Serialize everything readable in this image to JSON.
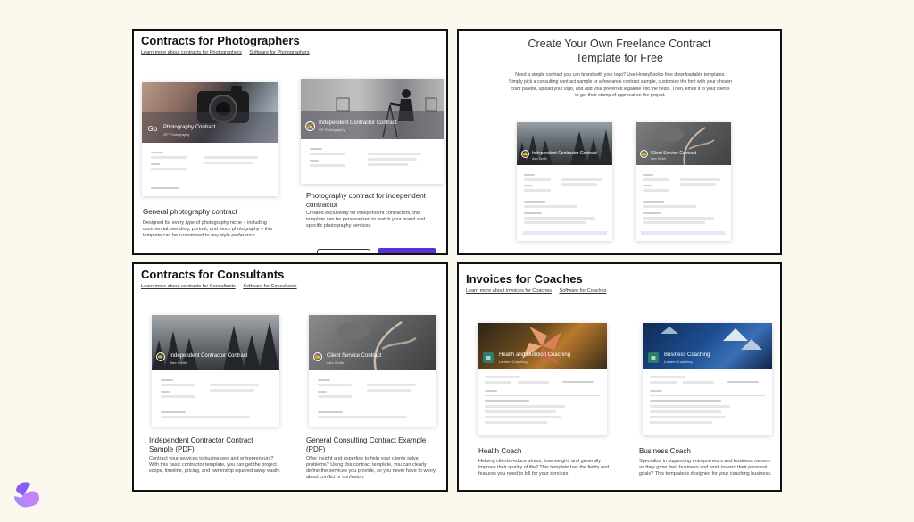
{
  "panels": {
    "photographers": {
      "title": "Contracts for Photographers",
      "links": [
        "Learn more about contracts for Photographers",
        "Software for Photographers"
      ],
      "cards": [
        {
          "thumb_title": "Photography Contract",
          "thumb_sub": "GP Photography",
          "badge": "Gp",
          "title": "General photography contract",
          "desc": "Designed for every type of photography niche – including commercial, wedding, portrait, and stock photography – this template can be customized to any style preference."
        },
        {
          "thumb_title": "Independent Contractor Contract",
          "thumb_sub": "GP Photography",
          "title": "Photography contract for independent contractor",
          "desc": "Created exclusively for independent contractors, this template can be personalized to match your brand and specific photography services."
        }
      ]
    },
    "freelance": {
      "title": "Create Your Own Freelance Contract Template for Free",
      "intro": "Need a simple contract you can brand with your logo? Use HoneyBook's free downloadable templates. Simply pick a consulting contract sample or a freelance contract sample, customize the font with your chosen color palette, upload your logo, and add your preferred legalese into the fields. Then, email it to your clients to get their stamp of approval on the project.",
      "cards": [
        {
          "thumb_title": "Independent Contractor Contract",
          "thumb_sub": "Alex Smith"
        },
        {
          "thumb_title": "Client Service Contract",
          "thumb_sub": "Alex Smith"
        }
      ]
    },
    "consultants": {
      "title": "Contracts for Consultants",
      "links": [
        "Learn more about contracts for Consultants",
        "Software for Consultants"
      ],
      "cards": [
        {
          "thumb_title": "Independent Contractor Contract",
          "thumb_sub": "Alex Smith",
          "title": "Independent Contractor Contract Sample (PDF)",
          "desc": "Contract your services to businesses and entrepreneurs? With this basic contractor template, you can get the project scope, timeline, pricing, and ownership squared away easily."
        },
        {
          "thumb_title": "Client Service Contract",
          "thumb_sub": "Alex Smith",
          "title": "General Consulting Contract Example (PDF)",
          "desc": "Offer insight and expertise to help your clients solve problems? Using this contract template, you can clearly define the services you provide, so you never have to worry about conflict or confusion."
        }
      ]
    },
    "coaches": {
      "title": "Invoices for Coaches",
      "links": [
        "Learn more about invoices for Coaches",
        "Software for Coaches"
      ],
      "cards": [
        {
          "thumb_title": "Health and Nutrition Coaching",
          "thumb_sub": "Lantern Coaching",
          "title": "Health Coach",
          "desc": "Helping clients reduce stress, lose weight, and generally improve their quality of life? This template has the fields and features you need to bill for your services."
        },
        {
          "thumb_title": "Business Coaching",
          "thumb_sub": "Lantern Coaching",
          "title": "Business Coach",
          "desc": "Specialize in supporting entrepreneurs and business owners as they grow their business and work toward their personal goals? This template is designed for your coaching business."
        }
      ]
    }
  },
  "colors": {
    "background": "#fbf8ee",
    "accent_purple": "#5a2fd8",
    "panel_border": "#111111"
  }
}
